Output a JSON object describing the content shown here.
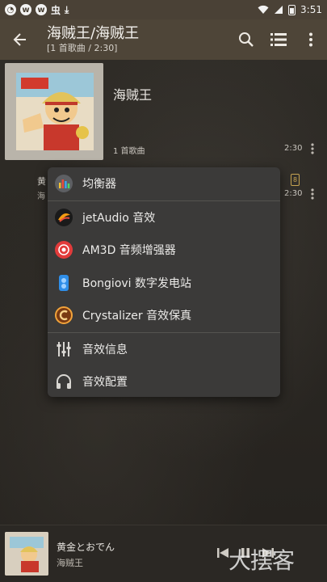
{
  "status_bar": {
    "time": "3:51",
    "notification_icons": [
      "generic-app-icon",
      "w-app-icon",
      "w-app-icon",
      "chat-app-icon",
      "download-icon"
    ]
  },
  "app_bar": {
    "title": "海贼王/海贼王",
    "subtitle": "[1 首歌曲 / 2:30]"
  },
  "album": {
    "title": "海贼王",
    "song_count": "1 首歌曲",
    "duration": "2:30"
  },
  "track_row": {
    "title_partial": "黄",
    "artist_partial": "海",
    "duration": "2:30",
    "badge": "8"
  },
  "menu": {
    "items": [
      {
        "label": "均衡器",
        "icon": "equalizer-icon"
      },
      {
        "label": "jetAudio 音效",
        "icon": "jetaudio-icon"
      },
      {
        "label": "AM3D 音频增强器",
        "icon": "am3d-icon"
      },
      {
        "label": "Bongiovi 数字发电站",
        "icon": "bongiovi-icon"
      },
      {
        "label": "Crystalizer 音效保真",
        "icon": "crystalizer-icon"
      },
      {
        "label": "音效信息",
        "icon": "sliders-icon"
      },
      {
        "label": "音效配置",
        "icon": "headphones-icon"
      }
    ]
  },
  "player": {
    "title": "黄金とおでん",
    "artist": "海贼王"
  },
  "watermark": "大摆客",
  "colors": {
    "app_bar": "#4e4538",
    "status_bar": "#4a4136",
    "menu_bg": "#3b3a39",
    "accent_gold": "#c7a452"
  }
}
